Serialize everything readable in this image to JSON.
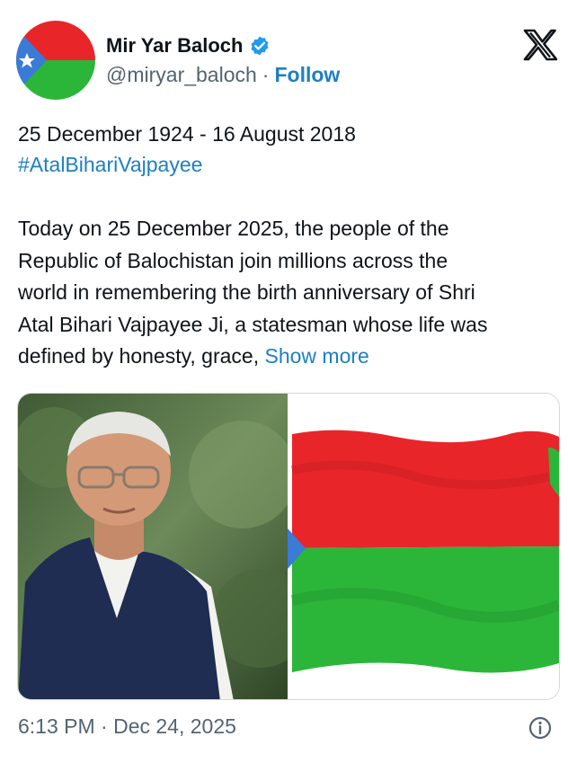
{
  "author": {
    "name": "Mir Yar Baloch",
    "handle": "@miryar_baloch",
    "separator": "·",
    "follow_label": "Follow",
    "verified_icon": "verified-badge-icon"
  },
  "platform_icon": "x-logo-icon",
  "tweet": {
    "dates_line": "25 December 1924 - 16 August 2018",
    "hashtag": "#AtalBihariVajpayee",
    "text_lines": [
      "Today on 25 December 2025, the people of the",
      "Republic of Balochistan join millions across the",
      "world in remembering the birth anniversary of Shri",
      "Atal Bihari Vajpayee Ji, a statesman whose life was",
      "defined by honesty, grace, "
    ],
    "show_more_label": "Show more"
  },
  "media": [
    {
      "kind": "photo",
      "icon": "portrait-photo"
    },
    {
      "kind": "photo",
      "icon": "flag-photo"
    }
  ],
  "footer": {
    "timestamp": "6:13 PM · Dec 24, 2025",
    "info_icon": "info-icon"
  },
  "colors": {
    "link": "#1d7fc4",
    "secondary_text": "#536471",
    "flag_red": "#e8262a",
    "flag_green": "#2bb63a",
    "flag_blue": "#3a7bd5",
    "verified": "#1d9bf0"
  }
}
